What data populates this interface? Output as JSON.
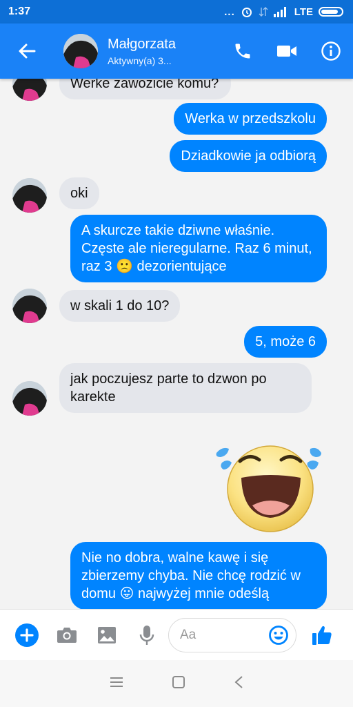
{
  "status_bar": {
    "time": "1:37",
    "dots": "...",
    "network": "LTE"
  },
  "header": {
    "contact_name": "Małgorzata",
    "contact_status": "Aktywny(a) 3..."
  },
  "messages": [
    {
      "side": "in",
      "text": "Werke zawozicie komu?"
    },
    {
      "side": "out",
      "text": "Werka w przedszkolu"
    },
    {
      "side": "out",
      "text": "Dziadkowie ja odbiorą"
    },
    {
      "side": "in",
      "text": "oki"
    },
    {
      "side": "out",
      "text": "A skurcze takie dziwne właśnie. Częste ale nieregularne. Raz 6 minut, raz 3 🙁 dezorientujące"
    },
    {
      "side": "in",
      "text": "w skali 1 do 10?"
    },
    {
      "side": "out",
      "text": "5, może 6"
    },
    {
      "side": "in",
      "text": "jak poczujesz parte to dzwon po karekte"
    },
    {
      "side": "out",
      "sticker": "laughing-emoji-sticker"
    },
    {
      "side": "out",
      "text": "Nie no dobra, walne kawę i się zbierzemy chyba. Nie chcę rodzić w domu 😛 najwyżej mnie odeślą"
    }
  ],
  "composer": {
    "placeholder": "Aa"
  },
  "colors": {
    "header": "#1a82f7",
    "status_bar": "#0d6fd6",
    "outgoing_bubble": "#0084ff",
    "incoming_bubble": "#e4e6eb"
  },
  "icons": [
    "back-arrow-icon",
    "phone-icon",
    "video-camera-icon",
    "info-icon",
    "plus-icon",
    "camera-icon",
    "image-icon",
    "microphone-icon",
    "emoji-icon",
    "thumbs-up-icon",
    "menu-icon",
    "home-square-icon",
    "back-triangle-icon"
  ]
}
